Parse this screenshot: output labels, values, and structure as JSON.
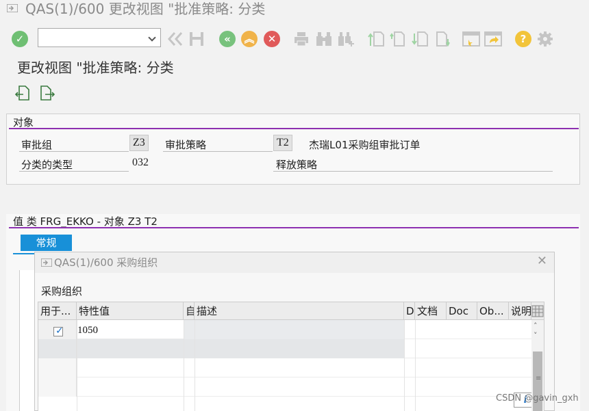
{
  "window": {
    "title": "QAS(1)/600 更改视图 \"批准策略: 分类"
  },
  "screen": {
    "title": "更改视图 \"批准策略: 分类"
  },
  "toolbar": {
    "command_field_value": "",
    "icons": [
      "check-icon",
      "back-double-icon",
      "save-icon",
      "back-icon",
      "exit-icon",
      "cancel-icon",
      "print-icon",
      "find-icon",
      "find-next-icon",
      "first-page-icon",
      "prev-page-icon",
      "next-page-icon",
      "last-page-icon",
      "new-session-icon",
      "shortcut-icon",
      "help-icon",
      "settings-icon"
    ]
  },
  "object_section": {
    "title": "对象",
    "fields": {
      "approval_group_label": "审批组",
      "approval_group_value": "Z3",
      "approval_strategy_label": "审批策略",
      "approval_strategy_value": "T2",
      "strategy_description": "杰瑞L01采购组审批订单",
      "class_type_label": "分类的类型",
      "class_type_value": "032",
      "release_strategy_label": "释放策略"
    }
  },
  "values_section": {
    "title": "值 类 FRG_EKKO - 对象 Z3 T2",
    "tabs": [
      {
        "label": "常规",
        "active": true
      }
    ]
  },
  "popup": {
    "title": "QAS(1)/600 采购组织",
    "close": "✕",
    "subtitle": "采购组织",
    "columns": [
      "用于...",
      "特性值",
      "自",
      "描述",
      "D",
      "文档",
      "Doc",
      "Ob...",
      "说明"
    ],
    "rows": [
      {
        "selected": true,
        "value": "1050",
        "description": ""
      }
    ],
    "info_button": "i"
  },
  "watermark": "CSDN @gavin_gxh",
  "colors": {
    "section_line": "#8d2fb0",
    "tab_active": "#1890d8",
    "ok_green": "#6fbf73",
    "nav_green": "#78c27d",
    "nav_orange": "#f0b34a",
    "cancel_red": "#e05a5a",
    "help_yellow": "#f2c43a"
  }
}
